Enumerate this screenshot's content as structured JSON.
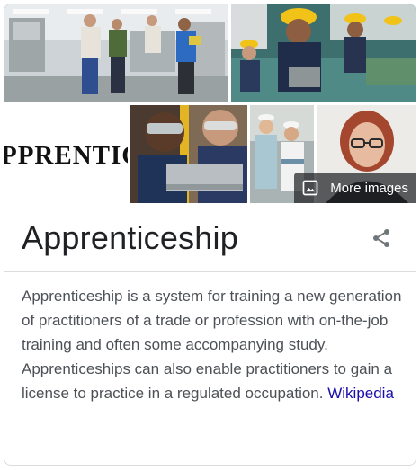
{
  "gallery": {
    "more_images_label": "More images",
    "banner_text": "PPRENTIC"
  },
  "panel": {
    "title": "Apprenticeship",
    "description": "Apprenticeship is a system for training a new generation of practitioners of a trade or profession with on-the-job training and often some accompanying study. Apprenticeships can also enable practitioners to gain a license to practice in a regulated occupation.",
    "source_link": "Wikipedia"
  },
  "icons": {
    "share": "share-icon",
    "image": "image-icon"
  },
  "colors": {
    "title": "#202124",
    "body_text": "#4d5156",
    "link": "#1a0dab",
    "border": "#dadce0"
  }
}
